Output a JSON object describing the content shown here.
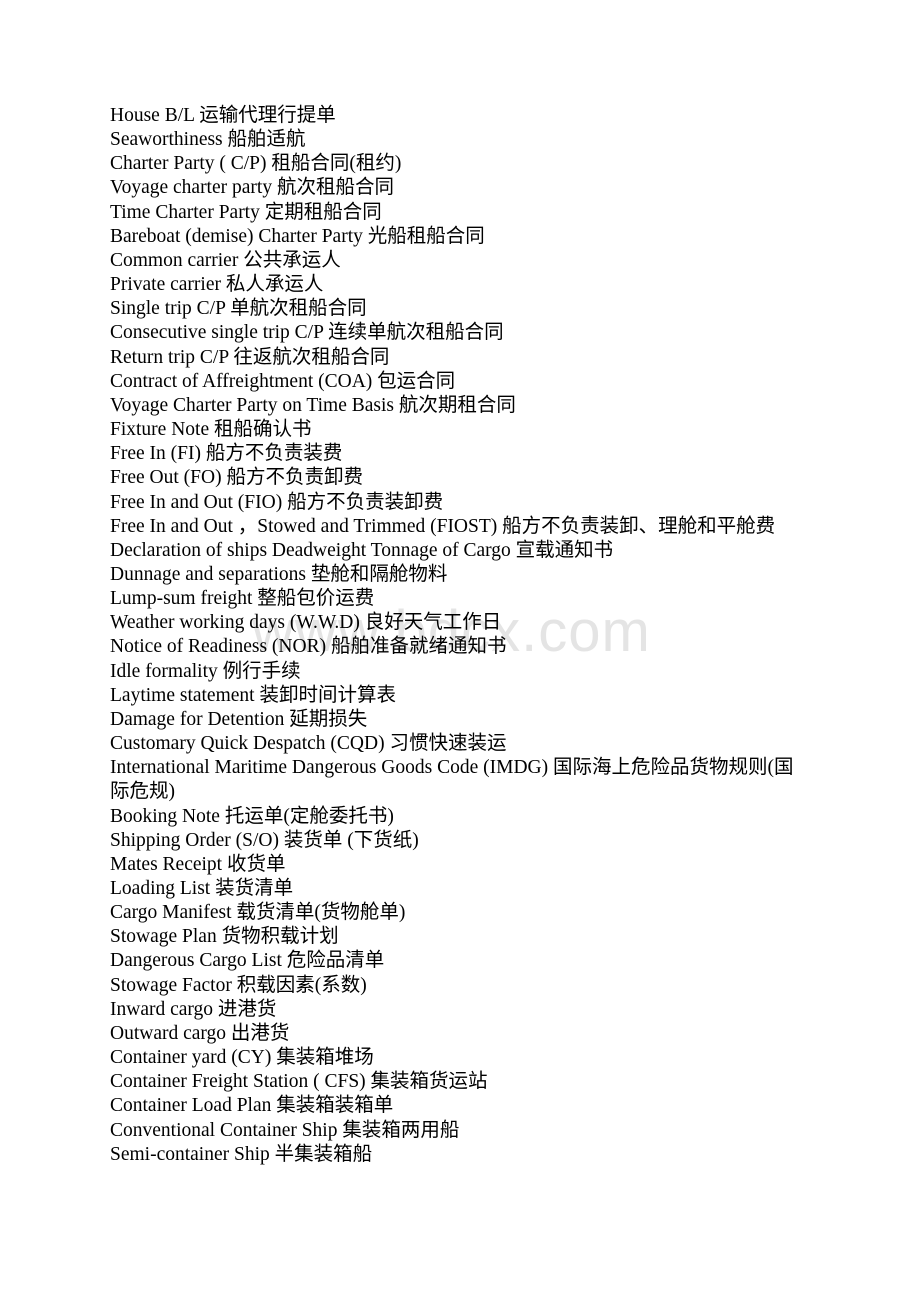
{
  "document": {
    "type": "glossary-list",
    "language": "en-zh",
    "watermark": "www.bdcx.com",
    "watermark_color": "#e4e4e4",
    "text_color": "#000000",
    "background_color": "#ffffff",
    "lines": [
      "House B/L 运输代理行提单",
      "Seaworthiness 船舶适航",
      "Charter Party ( C/P) 租船合同(租约)",
      "Voyage charter party 航次租船合同",
      "Time Charter Party 定期租船合同",
      "Bareboat (demise) Charter Party 光船租船合同",
      "Common carrier 公共承运人",
      "Private carrier 私人承运人",
      "Single trip C/P 单航次租船合同",
      "Consecutive single trip C/P 连续单航次租船合同",
      "Return trip C/P 往返航次租船合同",
      "Contract of Affreightment (COA) 包运合同",
      "Voyage Charter Party on Time Basis 航次期租合同",
      "Fixture Note 租船确认书",
      "Free In (FI) 船方不负责装费",
      "Free Out (FO) 船方不负责卸费",
      "Free In and Out (FIO) 船方不负责装卸费",
      "Free In and Out ，Stowed and Trimmed (FIOST) 船方不负责装卸、理舱和平舱费",
      "Declaration of ships Deadweight Tonnage of Cargo 宣载通知书",
      "Dunnage and separations 垫舱和隔舱物料",
      "Lump-sum freight 整船包价运费",
      "Weather working days (W.W.D) 良好天气工作日",
      "Notice of Readiness (NOR) 船舶准备就绪通知书",
      "Idle formality 例行手续",
      "Laytime statement 装卸时间计算表",
      "Damage for Detention 延期损失",
      "Customary Quick Despatch (CQD) 习惯快速装运",
      "International Maritime Dangerous Goods Code (IMDG) 国际海上危险品货物规则(国际危规)",
      "Booking Note 托运单(定舱委托书)",
      "Shipping Order (S/O) 装货单 (下货纸)",
      "Mates Receipt 收货单",
      "Loading List 装货清单",
      "Cargo Manifest 载货清单(货物舱单)",
      "Stowage Plan 货物积载计划",
      "Dangerous Cargo List 危险品清单",
      "Stowage Factor 积载因素(系数)",
      "Inward cargo 进港货",
      "Outward cargo 出港货",
      "Container yard (CY) 集装箱堆场",
      "Container Freight Station ( CFS) 集装箱货运站",
      "Container Load Plan 集装箱装箱单",
      "Conventional Container Ship 集装箱两用船",
      "Semi-container Ship 半集装箱船"
    ]
  }
}
